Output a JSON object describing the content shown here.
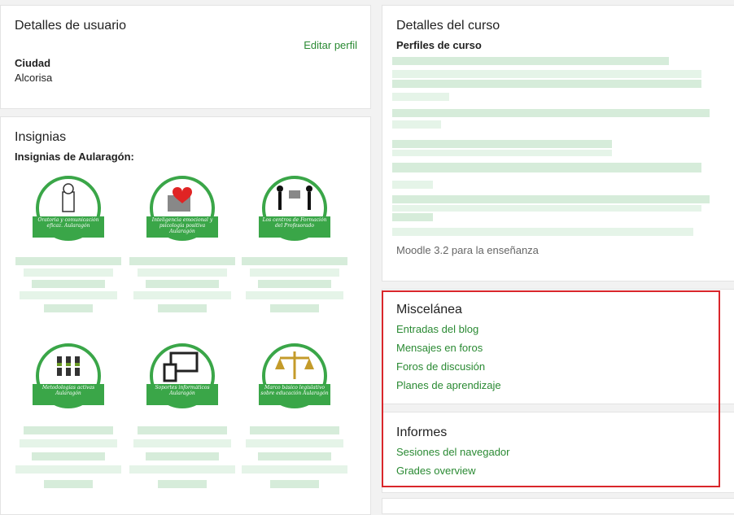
{
  "user_details": {
    "title": "Detalles de usuario",
    "edit_link": "Editar perfil",
    "city_label": "Ciudad",
    "city_value": "Alcorisa"
  },
  "badges": {
    "title": "Insignias",
    "subtitle": "Insignias de Aularagón:",
    "items": [
      {
        "ribbon": "Oratoria y comunicación eficaz. Aularagón"
      },
      {
        "ribbon": "Inteligencia emocional y psicología positiva Aularagón"
      },
      {
        "ribbon": "Los centros de Formación del Profesorado"
      },
      {
        "ribbon": "Metodologías activas Aularagón"
      },
      {
        "ribbon": "Soportes informáticos Aularagón"
      },
      {
        "ribbon": "Marco básico legislativo sobre educación Aularagón"
      }
    ]
  },
  "course_details": {
    "title": "Detalles del curso",
    "profiles_label": "Perfiles de curso",
    "footer": "Moodle 3.2 para la enseñanza"
  },
  "misc": {
    "title": "Miscelánea",
    "links": [
      "Entradas del blog",
      "Mensajes en foros",
      "Foros de discusión",
      "Planes de aprendizaje"
    ]
  },
  "reports": {
    "title": "Informes",
    "links": [
      "Sesiones del navegador",
      "Grades overview"
    ]
  },
  "colors": {
    "link": "#2a8a33",
    "highlight": "#d9262b",
    "badge_green": "#3aa648"
  }
}
